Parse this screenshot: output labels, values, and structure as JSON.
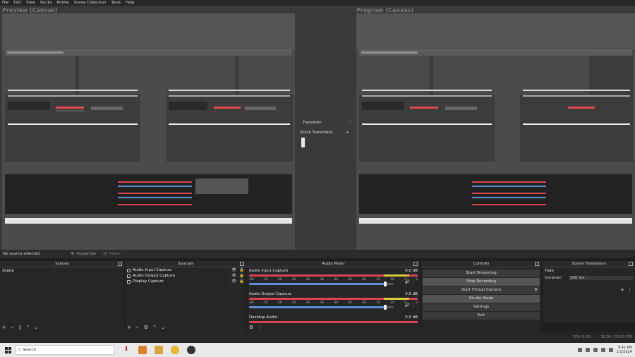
{
  "menu": [
    "File",
    "Edit",
    "View",
    "Docks",
    "Profile",
    "Scene Collection",
    "Tools",
    "Help"
  ],
  "preview": {
    "label": "Preview (Canvas)"
  },
  "program": {
    "label": "Program (Canvas)"
  },
  "transition": {
    "row1": "Transition",
    "row2": "Quick Transitions",
    "more": "⋮",
    "add": "+"
  },
  "statusline": {
    "no_source": "No source selected",
    "properties": "Properties",
    "filters": "Filters"
  },
  "scenes": {
    "title": "Scenes",
    "items": [
      "Scene"
    ]
  },
  "sources": {
    "title": "Sources",
    "items": [
      "Audio Input Capture",
      "Audio Output Capture",
      "Display Capture"
    ]
  },
  "mixer": {
    "title": "Audio Mixer",
    "channels": [
      {
        "name": "Audio Input Capture",
        "db": "0.0 dB",
        "level": 0.95
      },
      {
        "name": "Audio Output Capture",
        "db": "0.0 dB",
        "level": 0.95
      },
      {
        "name": "Desktop Audio",
        "db": "0.0 dB",
        "level": 0
      }
    ],
    "ticks": [
      "-60",
      "-55",
      "-50",
      "-45",
      "-40",
      "-35",
      "-30",
      "-25",
      "-20",
      "-15",
      "-10",
      "-5",
      "0"
    ]
  },
  "controls": {
    "title": "Controls",
    "buttons": [
      "Start Streaming",
      "Stop Recording",
      "Start Virtual Camera",
      "Studio Mode",
      "Settings",
      "Exit"
    ]
  },
  "scene_transitions": {
    "title": "Scene Transitions",
    "transition": "Fade",
    "duration_label": "Duration",
    "duration_value": "300 ms"
  },
  "obs_status": [
    "",
    "",
    "",
    "CPU: 0.3%",
    "30.00 / 30.00 FPS"
  ],
  "taskbar": {
    "search_placeholder": "Search",
    "time": "9:41 PM",
    "date": "1/1/2024"
  },
  "colors": {
    "meter_red": "#d9434f",
    "meter_yellow": "#d6c93a",
    "meter_green": "#4ea64e",
    "slider_blue": "#5a8fd8"
  }
}
